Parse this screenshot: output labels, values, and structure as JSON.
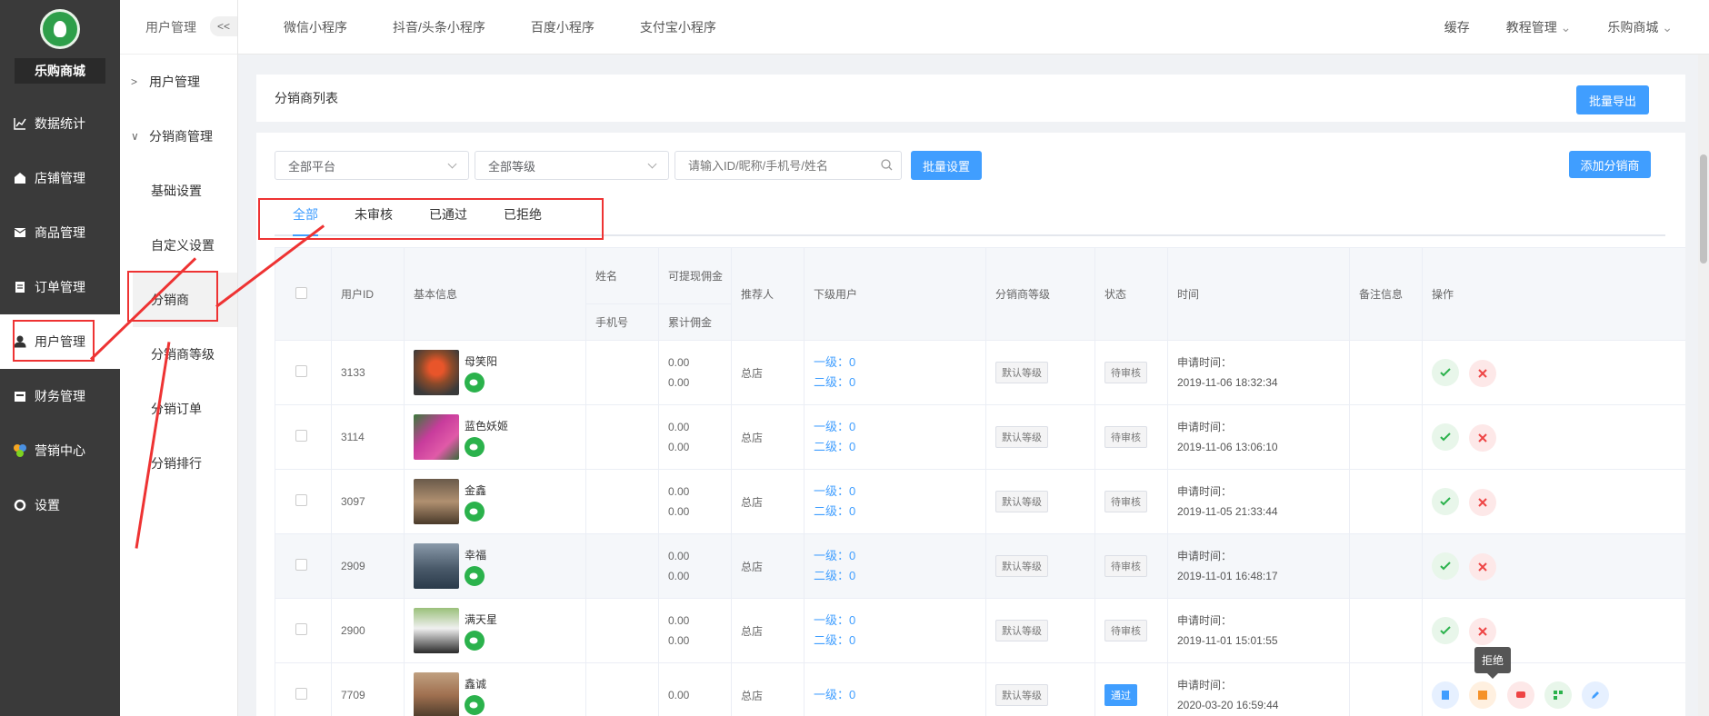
{
  "brand": {
    "name": "乐购商城"
  },
  "nav": [
    {
      "label": "数据统计",
      "icon": "chart-icon"
    },
    {
      "label": "店铺管理",
      "icon": "store-icon"
    },
    {
      "label": "商品管理",
      "icon": "goods-icon"
    },
    {
      "label": "订单管理",
      "icon": "order-icon"
    },
    {
      "label": "用户管理",
      "icon": "user-icon"
    },
    {
      "label": "财务管理",
      "icon": "finance-icon"
    },
    {
      "label": "营销中心",
      "icon": "marketing-icon"
    },
    {
      "label": "设置",
      "icon": "settings-icon"
    }
  ],
  "subnav": {
    "head": "用户管理",
    "collapse": "<<",
    "group1": "用户管理",
    "group2": "分销商管理",
    "items": [
      "基础设置",
      "自定义设置",
      "分销商",
      "分销商等级",
      "分销订单",
      "分销排行"
    ]
  },
  "topbar": {
    "tabs": [
      "微信小程序",
      "抖音/头条小程序",
      "百度小程序",
      "支付宝小程序"
    ],
    "cache": "缓存",
    "tutorial": "教程管理",
    "shop": "乐购商城"
  },
  "card1": {
    "title": "分销商列表",
    "export": "批量导出"
  },
  "filters": {
    "platform": "全部平台",
    "level": "全部等级",
    "search_placeholder": "请输入ID/昵称/手机号/姓名",
    "batch": "批量设置",
    "add": "添加分销商"
  },
  "tabs": [
    "全部",
    "未审核",
    "已通过",
    "已拒绝"
  ],
  "table": {
    "headers": {
      "userid": "用户ID",
      "basic": "基本信息",
      "name": "姓名",
      "phone": "手机号",
      "withdrawable": "可提现佣金",
      "total": "累计佣金",
      "referrer": "推荐人",
      "sub": "下级用户",
      "level": "分销商等级",
      "status": "状态",
      "time": "时间",
      "remark": "备注信息",
      "ops": "操作"
    },
    "rows": [
      {
        "id": "3133",
        "nick": "母笑阳",
        "c1": "0.00",
        "c2": "0.00",
        "ref": "总店",
        "l1": "一级：0",
        "l2": "二级：0",
        "level": "默认等级",
        "status": "待审核",
        "tlabel": "申请时间：",
        "time": "2019-11-06 18:32:34"
      },
      {
        "id": "3114",
        "nick": "蓝色妖姬",
        "c1": "0.00",
        "c2": "0.00",
        "ref": "总店",
        "l1": "一级：0",
        "l2": "二级：0",
        "level": "默认等级",
        "status": "待审核",
        "tlabel": "申请时间：",
        "time": "2019-11-06 13:06:10"
      },
      {
        "id": "3097",
        "nick": "金鑫",
        "c1": "0.00",
        "c2": "0.00",
        "ref": "总店",
        "l1": "一级：0",
        "l2": "二级：0",
        "level": "默认等级",
        "status": "待审核",
        "tlabel": "申请时间：",
        "time": "2019-11-05 21:33:44"
      },
      {
        "id": "2909",
        "nick": "幸福",
        "c1": "0.00",
        "c2": "0.00",
        "ref": "总店",
        "l1": "一级：0",
        "l2": "二级：0",
        "level": "默认等级",
        "status": "待审核",
        "tlabel": "申请时间：",
        "time": "2019-11-01 16:48:17"
      },
      {
        "id": "2900",
        "nick": "满天星",
        "c1": "0.00",
        "c2": "0.00",
        "ref": "总店",
        "l1": "一级：0",
        "l2": "二级：0",
        "level": "默认等级",
        "status": "待审核",
        "tlabel": "申请时间：",
        "time": "2019-11-01 15:01:55"
      },
      {
        "id": "7709",
        "nick": "鑫诚",
        "c1": "0.00",
        "c2": "",
        "ref": "总店",
        "l1": "一级：0",
        "l2": "",
        "level": "默认等级",
        "status": "通过",
        "tlabel": "申请时间：",
        "time": "2020-03-20 16:59:44"
      }
    ]
  },
  "tooltip": "拒绝",
  "colors": {
    "accent": "#409eff",
    "annotation": "#ee3333",
    "wechat": "#2bb24c"
  }
}
